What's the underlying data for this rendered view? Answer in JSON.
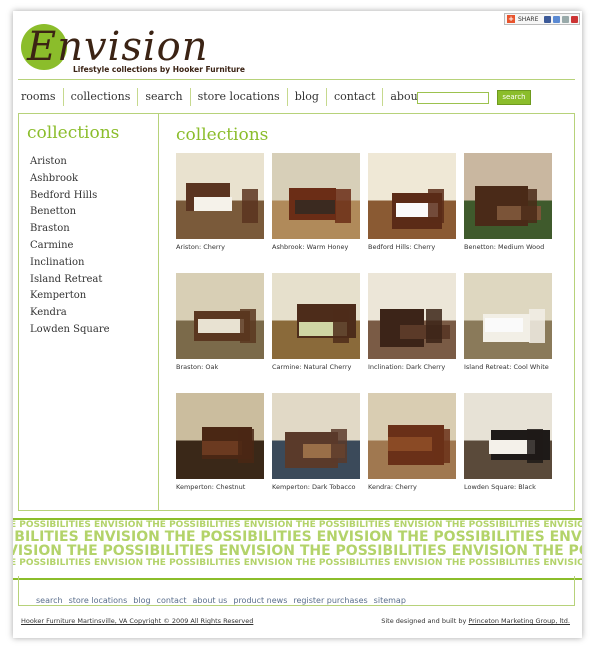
{
  "share": {
    "label": "SHARE"
  },
  "header": {
    "logo_text": "Envision",
    "tagline": "Lifestyle collections by Hooker Furniture"
  },
  "nav": {
    "items": [
      "rooms",
      "collections",
      "search",
      "store locations",
      "blog",
      "contact",
      "about us"
    ],
    "search_placeholder": "",
    "search_button": "search"
  },
  "sidebar": {
    "title": "collections",
    "items": [
      "Ariston",
      "Ashbrook",
      "Bedford Hills",
      "Benetton",
      "Braston",
      "Carmine",
      "Inclination",
      "Island Retreat",
      "Kemperton",
      "Kendra",
      "Lowden Square"
    ]
  },
  "main": {
    "title": "collections",
    "cards": [
      {
        "caption": "Ariston: Cherry",
        "scene": "bedroom-iron-bed"
      },
      {
        "caption": "Ashbrook: Warm Honey",
        "scene": "entertainment-center"
      },
      {
        "caption": "Bedford Hills: Cherry",
        "scene": "bedroom-sleigh"
      },
      {
        "caption": "Benetton: Medium Wood",
        "scene": "dining-set"
      },
      {
        "caption": "Braston: Oak",
        "scene": "bedroom-oak"
      },
      {
        "caption": "Carmine: Natural Cherry",
        "scene": "bedroom-bench"
      },
      {
        "caption": "Inclination: Dark Cherry",
        "scene": "tall-chest"
      },
      {
        "caption": "Island Retreat: Cool White",
        "scene": "bedroom-white"
      },
      {
        "caption": "Kemperton: Chestnut",
        "scene": "media-cabinet"
      },
      {
        "caption": "Kemperton: Dark Tobacco",
        "scene": "dining-round"
      },
      {
        "caption": "Kendra: Cherry",
        "scene": "bedroom-dresser"
      },
      {
        "caption": "Lowden Square: Black",
        "scene": "bedroom-poster"
      }
    ]
  },
  "band": {
    "line1": "E POSSIBILITIES ENVISION THE POSSIBILITIES ENVISION THE POSSIBILITIES ENVISION THE POSSIBILITIES ENVISION THE POSSIBILITIES",
    "line2": "SIBILITIES ENVISION THE POSSIBILITIES ENVISION THE POSSIBILITIES ENVISION THE POSSIBILITIES",
    "line3": "VISION THE POSSIBILITIES ENVISION THE POSSIBILITIES ENVISION THE POSSIBILITIES ENVISION",
    "line4": "E POSSIBILITIES ENVISION THE POSSIBILITIES ENVISION THE POSSIBILITIES ENVISION THE POSSIBILITIES ENVISION THE POSSIBILITIES"
  },
  "footer": {
    "links": [
      "search",
      "store locations",
      "blog",
      "contact",
      "about us",
      "product news",
      "register purchases",
      "sitemap"
    ],
    "copyright": "Hooker Furniture Martinsville, VA Copyright © 2009 All Rights Reserved",
    "credit_prefix": "Site designed and built by",
    "credit_link": "Princeton Marketing Group, ltd."
  },
  "colors": {
    "accent": "#8bbd2b",
    "brown": "#3b2314",
    "border": "#b7d27a"
  }
}
